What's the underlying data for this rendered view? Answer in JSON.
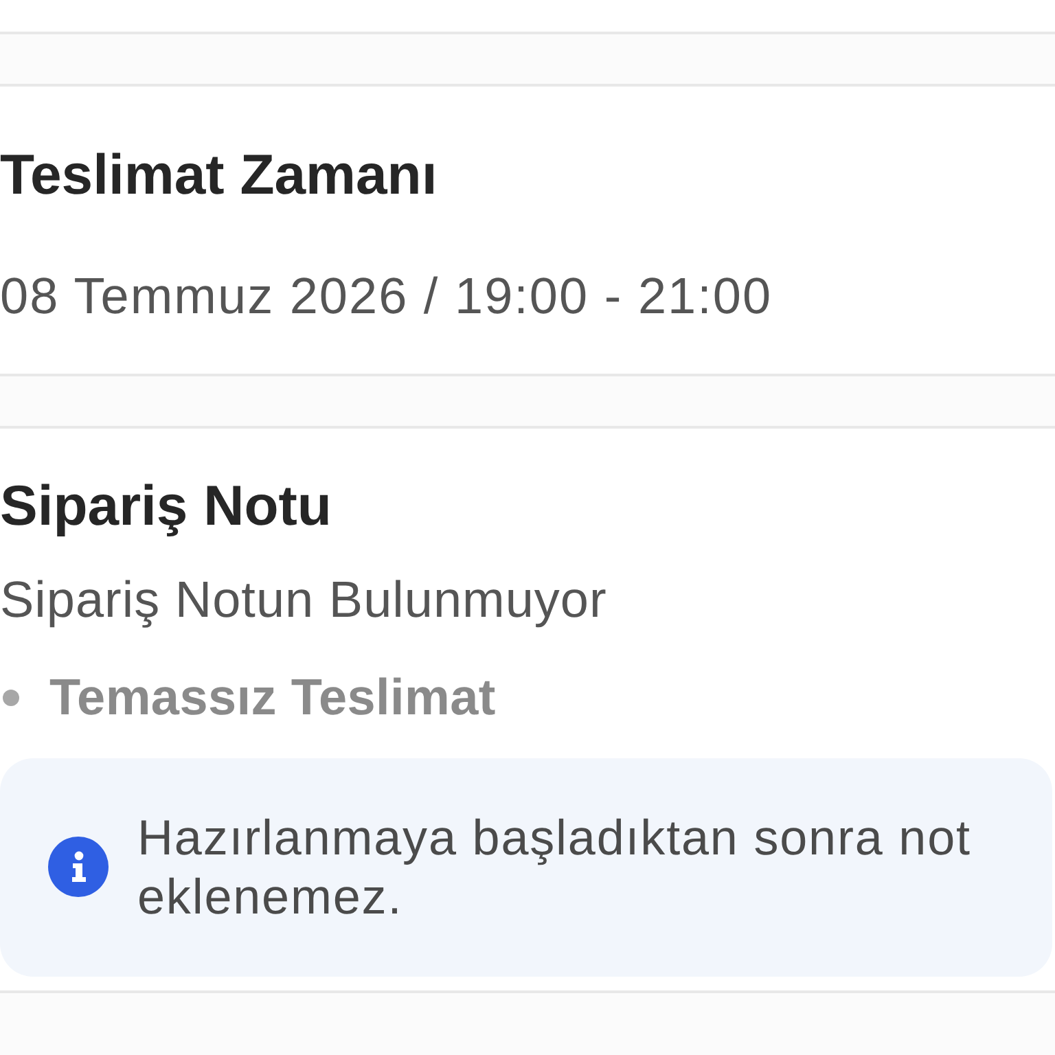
{
  "sections": [
    {
      "kind": "schedule",
      "title": "Teslimat Zamanı",
      "value": "08 Temmuz 2026 / 19:00 - 21:00"
    },
    {
      "kind": "note",
      "title": "Sipariş Notu",
      "value": "Sipariş Notun Bulunmuyor",
      "tags": [
        {
          "label": "Temassız Teslimat"
        }
      ],
      "info": "Hazırlanmaya başladıktan sonra not eklenemez."
    }
  ]
}
